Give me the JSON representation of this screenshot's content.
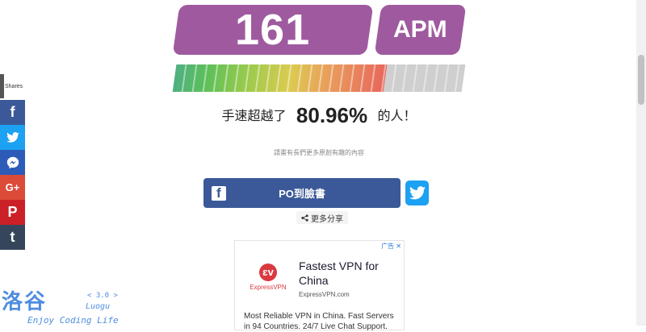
{
  "score": {
    "value": "161",
    "unit": "APM"
  },
  "speed_bar": {
    "fill_fraction": 0.73,
    "colors": [
      "#4fb082",
      "#5cbf5a",
      "#9ccb4c",
      "#dccb50",
      "#e9a05c",
      "#e8665c"
    ]
  },
  "result": {
    "prefix": "手速超越了",
    "percent": "80.96%",
    "suffix": "的人！"
  },
  "note": "請畫有長們更多原創有趣的內容",
  "share": {
    "fb_label": "PO到臉書",
    "more_label": "更多分享",
    "shares_label": "Shares"
  },
  "sidebar": [
    {
      "icon": "facebook-icon",
      "glyph": "f",
      "color": "#3b5998"
    },
    {
      "icon": "twitter-icon",
      "glyph": "",
      "color": "#1da1f2"
    },
    {
      "icon": "messenger-icon",
      "glyph": "",
      "color": "#2d5bb8"
    },
    {
      "icon": "google-plus-icon",
      "glyph": "G+",
      "color": "#dc4a38"
    },
    {
      "icon": "pinterest-icon",
      "glyph": "P",
      "color": "#cb2027"
    },
    {
      "icon": "tumblr-icon",
      "glyph": "t",
      "color": "#35465c"
    }
  ],
  "ad": {
    "close_label": "广告",
    "brand": "ExpressVPN",
    "title": "Fastest VPN for China",
    "domain": "ExpressVPN.com",
    "description": "Most Reliable VPN in China. Fast Servers in 94 Countries. 24/7 Live Chat Support."
  },
  "watermark": {
    "chars": "洛谷",
    "version": "< 3.0 >",
    "sub": "Luogu",
    "slogan": "Enjoy Coding Life"
  }
}
